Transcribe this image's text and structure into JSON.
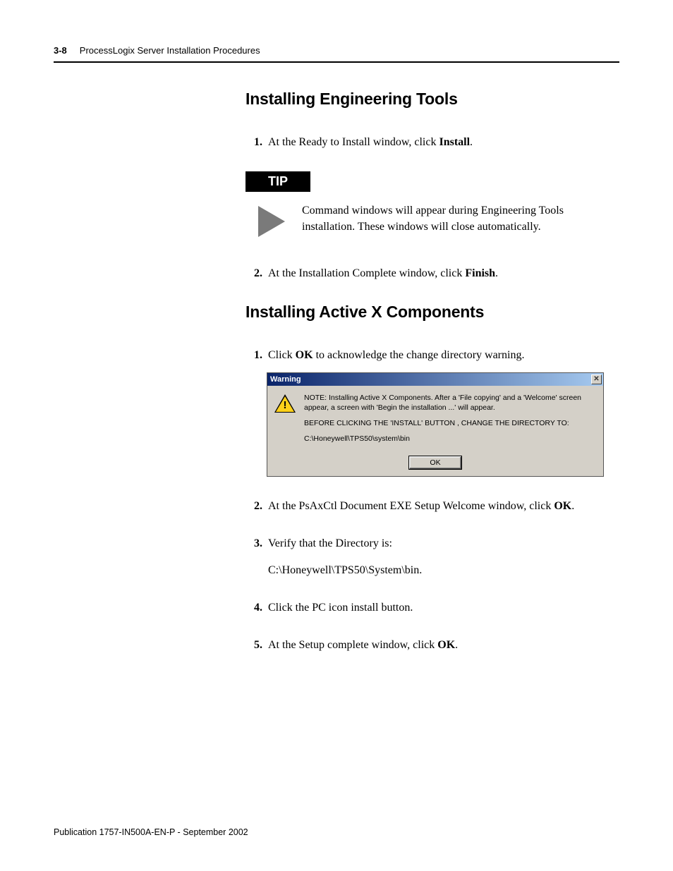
{
  "header": {
    "page_num": "3-8",
    "title": "ProcessLogix Server Installation Procedures"
  },
  "section1": {
    "heading": "Installing Engineering Tools",
    "step1_num": "1.",
    "step1_pre": "At the Ready to Install window, click ",
    "step1_b": "Install",
    "step1_post": ".",
    "tip_label": "TIP",
    "tip_text": "Command windows will appear during Engineering Tools installation. These windows will close automatically.",
    "step2_num": "2.",
    "step2_pre": "At the Installation Complete window, click ",
    "step2_b": "Finish",
    "step2_post": "."
  },
  "section2": {
    "heading": "Installing Active X Components",
    "step1_num": "1.",
    "step1_pre": "Click ",
    "step1_b": "OK",
    "step1_post": " to acknowledge the change directory warning.",
    "dialog": {
      "title": "Warning",
      "close": "✕",
      "line1": "NOTE: Installing Active X Components.  After a 'File copying' and a 'Welcome' screen appear, a screen with 'Begin the installation ...' will appear.",
      "line2": "BEFORE CLICKING THE  'INSTALL'  BUTTON , CHANGE THE DIRECTORY TO:",
      "line3": "C:\\Honeywell\\TPS50\\system\\bin",
      "ok": "OK"
    },
    "step2_num": "2.",
    "step2_pre": "At the PsAxCtl Document EXE Setup Welcome window, click ",
    "step2_b": "OK",
    "step2_post": ".",
    "step3_num": "3.",
    "step3_text": "Verify that the Directory is:",
    "step3_path": "C:\\Honeywell\\TPS50\\System\\bin.",
    "step4_num": "4.",
    "step4_text": "Click the PC icon install button.",
    "step5_num": "5.",
    "step5_pre": "At the Setup complete window, click ",
    "step5_b": "OK",
    "step5_post": "."
  },
  "footer": "Publication 1757-IN500A-EN-P - September 2002"
}
